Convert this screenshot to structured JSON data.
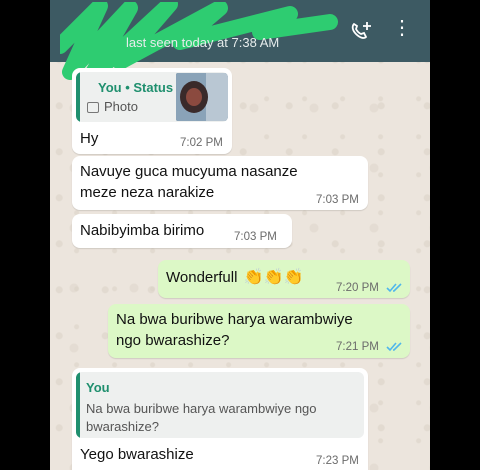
{
  "header": {
    "last_seen": "last seen today at 7:38 AM"
  },
  "messages": [
    {
      "quote_sender": "You • Status",
      "quote_label": "Photo",
      "text": "Hy",
      "time": "7:02 PM"
    },
    {
      "text_line1": "Navuye guca mucyuma nasanze",
      "text_line2": "meze neza narakize",
      "time": "7:03 PM"
    },
    {
      "text": "Nabibyimba birimo",
      "time": "7:03 PM"
    },
    {
      "text": "Wonderfull",
      "emoji": "👏👏👏",
      "time": "7:20 PM"
    },
    {
      "text_line1": "Na bwa buribwe harya warambwiye",
      "text_line2": "ngo bwarashize?",
      "time": "7:21 PM"
    },
    {
      "quote_sender": "You",
      "quote_line1": "Na bwa buribwe harya warambwiye ngo",
      "quote_line2": "bwarashize?",
      "text": "Yego bwarashize",
      "time": "7:23 PM"
    }
  ],
  "colors": {
    "header": "#3d5a63",
    "outgoing": "#dcf8c6",
    "incoming": "#ffffff",
    "read_ticks": "#4fb6ec",
    "scribble": "#2ecc71"
  }
}
